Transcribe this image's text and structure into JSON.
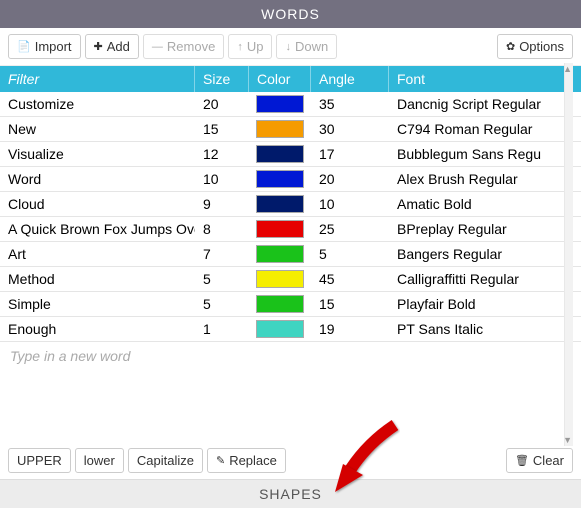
{
  "panel_title": "WORDS",
  "toolbar": {
    "import": "Import",
    "add": "Add",
    "remove": "Remove",
    "up": "Up",
    "down": "Down",
    "options": "Options"
  },
  "columns": {
    "filter": "Filter",
    "size": "Size",
    "color": "Color",
    "angle": "Angle",
    "font": "Font"
  },
  "rows": [
    {
      "word": "Customize",
      "size": "20",
      "color": "#0018d4",
      "angle": "35",
      "font": "Dancnig Script Regular"
    },
    {
      "word": "New",
      "size": "15",
      "color": "#f59b00",
      "angle": "30",
      "font": "C794 Roman Regular"
    },
    {
      "word": "Visualize",
      "size": "12",
      "color": "#001a6b",
      "angle": "17",
      "font": "Bubblegum Sans Regu"
    },
    {
      "word": "Word",
      "size": "10",
      "color": "#0018d4",
      "angle": "20",
      "font": "Alex Brush Regular"
    },
    {
      "word": "Cloud",
      "size": "9",
      "color": "#001a6b",
      "angle": "10",
      "font": "Amatic Bold"
    },
    {
      "word": "A Quick Brown Fox Jumps Ove",
      "size": "8",
      "color": "#e60000",
      "angle": "25",
      "font": "BPreplay Regular"
    },
    {
      "word": "Art",
      "size": "7",
      "color": "#1ac21a",
      "angle": "5",
      "font": "Bangers Regular"
    },
    {
      "word": "Method",
      "size": "5",
      "color": "#f5ee00",
      "angle": "45",
      "font": "Calligraffitti Regular"
    },
    {
      "word": "Simple",
      "size": "5",
      "color": "#1ac21a",
      "angle": "15",
      "font": "Playfair Bold"
    },
    {
      "word": "Enough",
      "size": "1",
      "color": "#3fd4c1",
      "angle": "19",
      "font": "PT Sans Italic"
    }
  ],
  "newword_placeholder": "Type in a new word",
  "bottombar": {
    "upper": "UPPER",
    "lower": "lower",
    "capitalize": "Capitalize",
    "replace": "Replace",
    "clear": "Clear"
  },
  "shapes_title": "SHAPES"
}
